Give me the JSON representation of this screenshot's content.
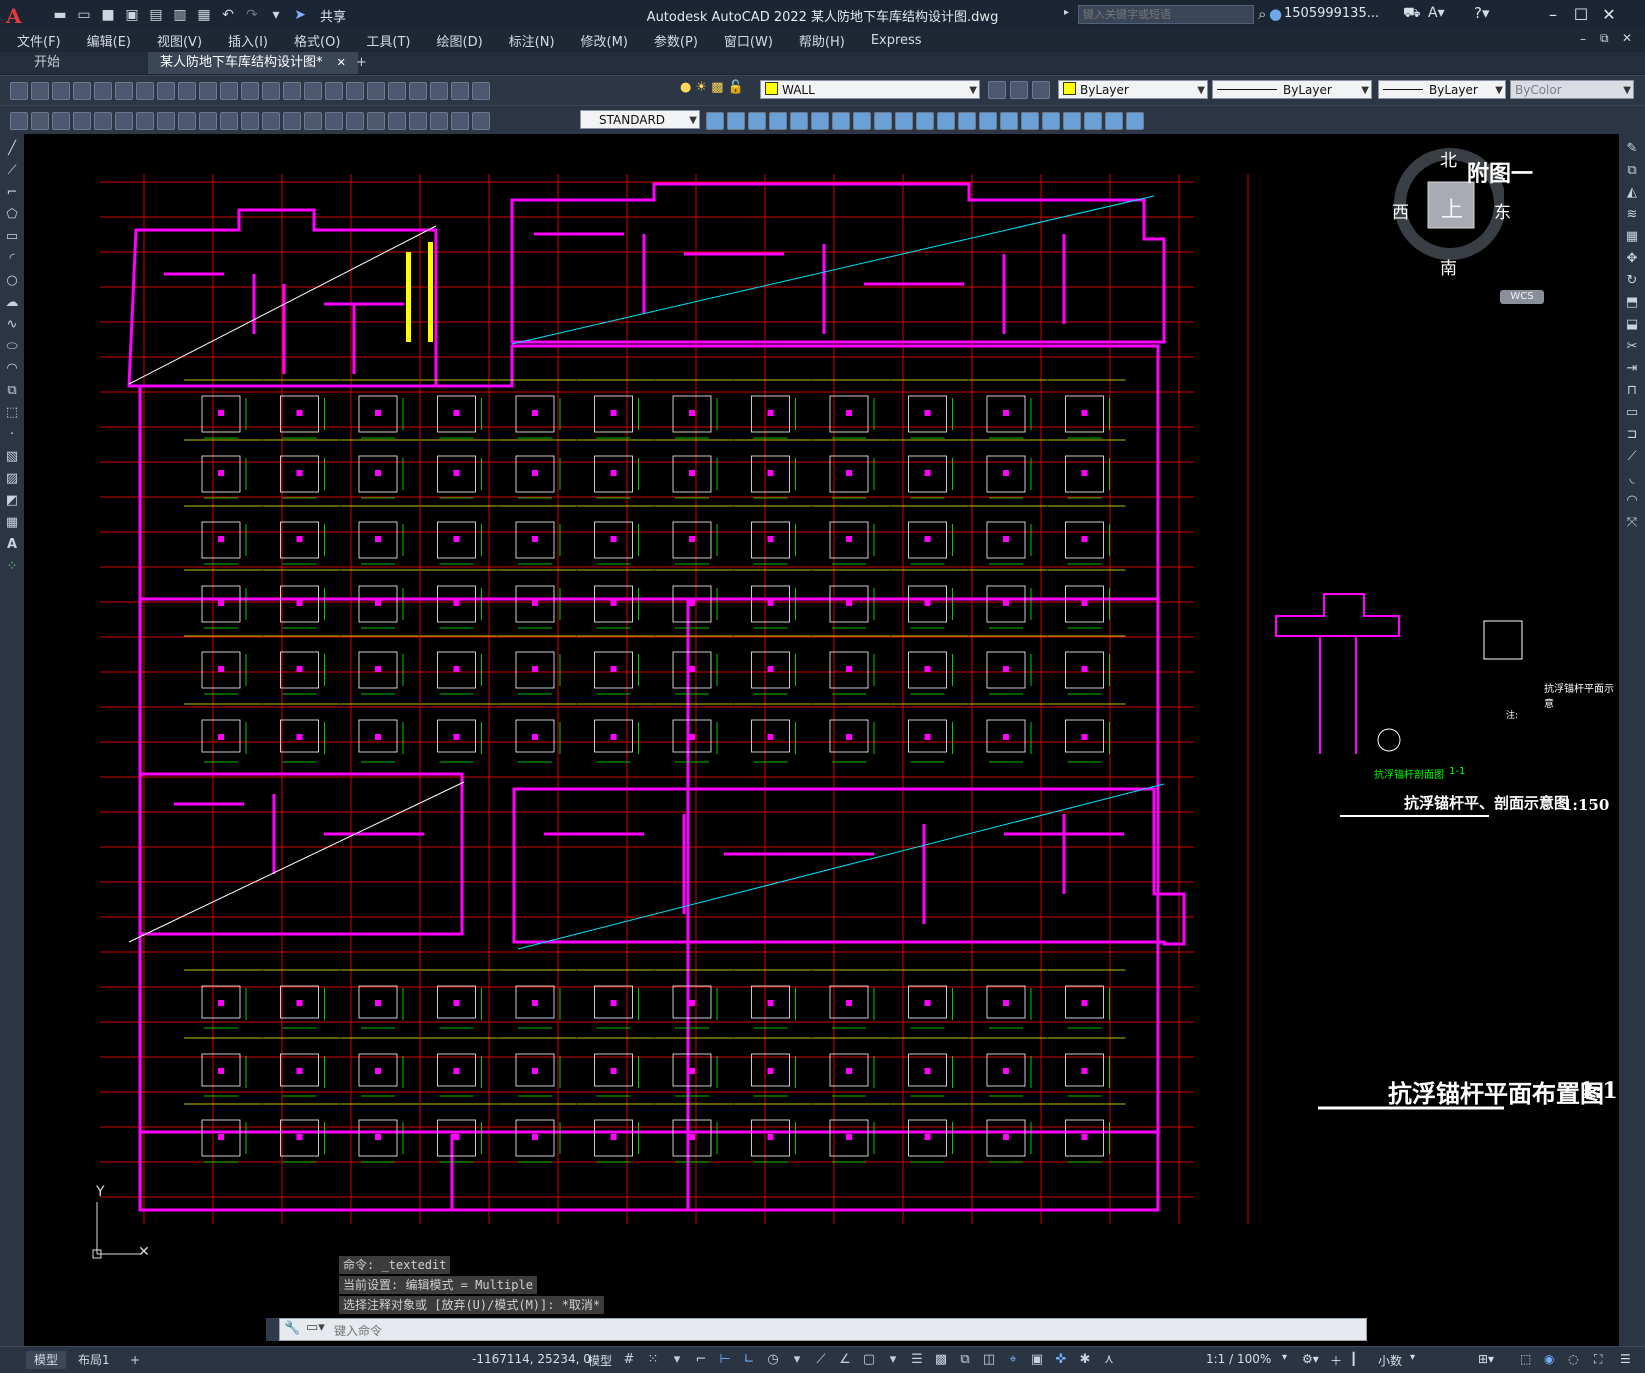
{
  "app": {
    "window_title": "Autodesk AutoCAD 2022    某人防地下车库结构设计图.dwg",
    "share_label": "共享",
    "search_placeholder": "键入关键字或短语",
    "user": "1505999135...",
    "logo_letter": "A"
  },
  "menu": [
    "文件(F)",
    "编辑(E)",
    "视图(V)",
    "插入(I)",
    "格式(O)",
    "工具(T)",
    "绘图(D)",
    "标注(N)",
    "修改(M)",
    "参数(P)",
    "窗口(W)",
    "帮助(H)",
    "Express"
  ],
  "tabs": {
    "start": "开始",
    "drawing": "某人防地下车库结构设计图*",
    "add": "+"
  },
  "toolbar": {
    "layer": "WALL",
    "color": "ByLayer",
    "linetype": "ByLayer",
    "lineweight": "ByLayer",
    "plotstyle": "ByColor",
    "textstyle": "STANDARD",
    "layer_swatch": "#ffff00",
    "color_swatch": "#ffff00"
  },
  "viewcube": {
    "north": "北",
    "south": "南",
    "east": "东",
    "west": "西",
    "face": "上",
    "wcs": "WCS"
  },
  "drawing": {
    "annex_label": "附图一",
    "plan_title": "抗浮锚杆平面布置图",
    "plan_scale": "1:1",
    "detail_title": "抗浮锚杆平、剖面示意图",
    "detail_scale": "1:150",
    "section_label_a": "抗浮锚杆剖面图",
    "section_label_b": "1-1",
    "section_label_c": "抗浮锚杆平面示意",
    "notes_label": "注:",
    "ucs_y": "Y",
    "colors": {
      "grid": "#d40000",
      "wall": "#ff00ff",
      "label": "#00ff00",
      "note": "#ffff00",
      "diag": "#00e5ff",
      "diag2": "#ffffff"
    }
  },
  "command": {
    "history": [
      "命令:  _textedit",
      "当前设置: 编辑模式 = Multiple",
      "选择注释对象或 [放弃(U)/模式(M)]: *取消*"
    ],
    "placeholder": "键入命令"
  },
  "status": {
    "model_tab": "模型",
    "layout_tab": "布局1",
    "add": "+",
    "coords": "-1167114, 25234, 0",
    "space": "模型",
    "scale": "1:1 / 100%",
    "units": "小数"
  }
}
